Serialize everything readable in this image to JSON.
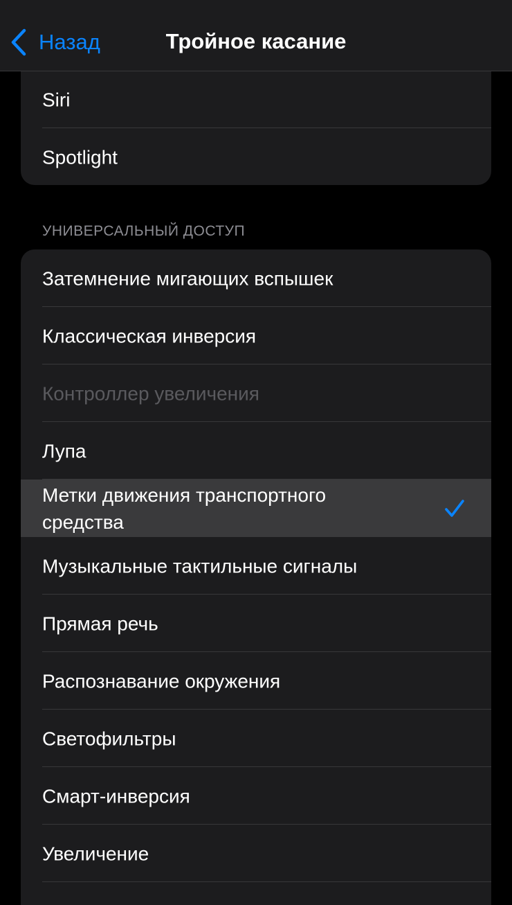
{
  "nav": {
    "back_label": "Назад",
    "title": "Тройное касание",
    "accent_color": "#0a84ff"
  },
  "top_group": {
    "items": [
      {
        "label": "Siri"
      },
      {
        "label": "Spotlight"
      }
    ]
  },
  "accessibility_section": {
    "header": "УНИВЕРСАЛЬНЫЙ ДОСТУП",
    "items": [
      {
        "label": "Затемнение мигающих вспышек",
        "state": "normal"
      },
      {
        "label": "Классическая инверсия",
        "state": "normal"
      },
      {
        "label": "Контроллер увеличения",
        "state": "disabled"
      },
      {
        "label": "Лупа",
        "state": "normal"
      },
      {
        "label": "Метки движения транспортного\nсредства",
        "state": "selected",
        "checked": true
      },
      {
        "label": "Музыкальные тактильные сигналы",
        "state": "normal"
      },
      {
        "label": "Прямая речь",
        "state": "normal"
      },
      {
        "label": "Распознавание окружения",
        "state": "normal"
      },
      {
        "label": "Светофильтры",
        "state": "normal"
      },
      {
        "label": "Смарт-инверсия",
        "state": "normal"
      },
      {
        "label": "Увеличение",
        "state": "normal"
      }
    ]
  },
  "icons": {
    "back": "chevron-left-icon",
    "check": "checkmark-icon"
  }
}
